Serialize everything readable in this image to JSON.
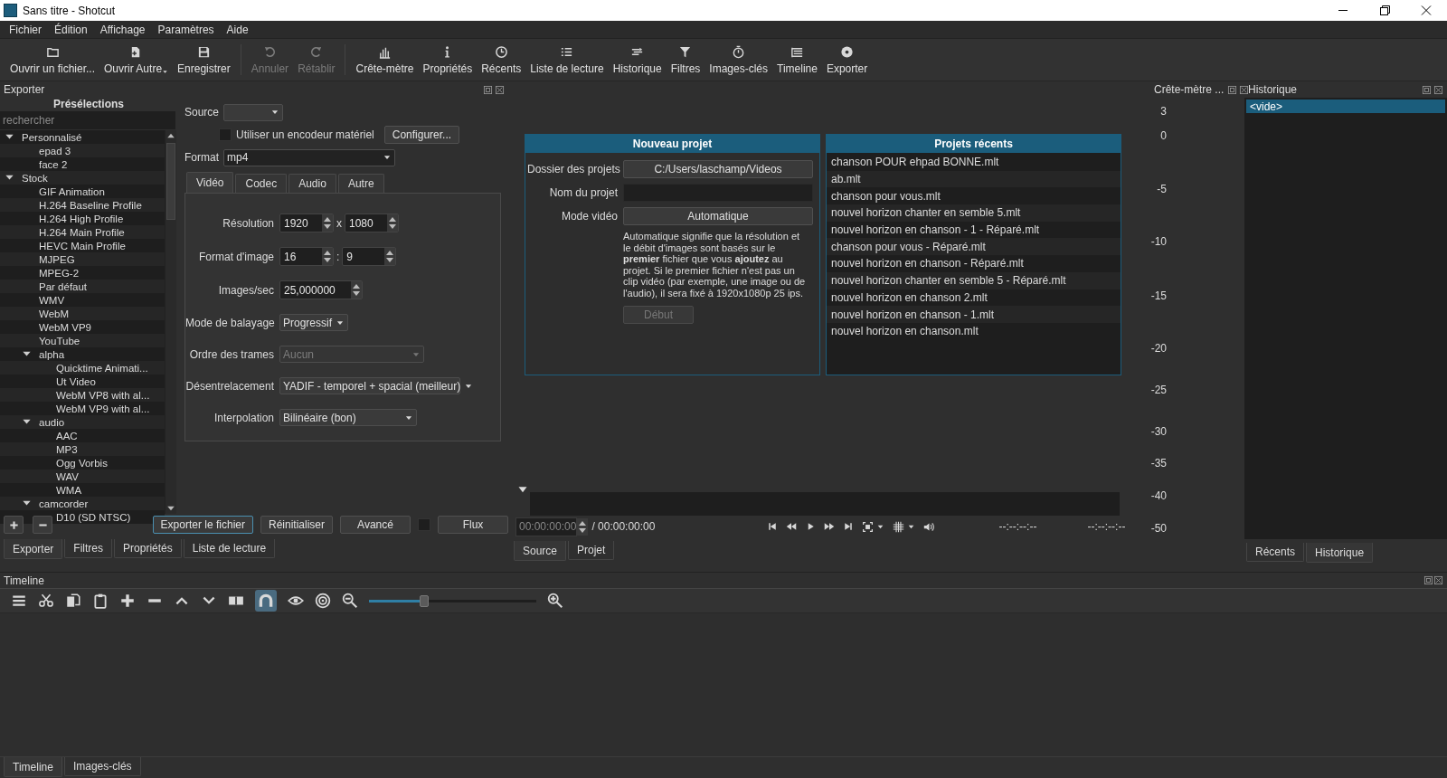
{
  "window": {
    "title": "Sans titre - Shotcut"
  },
  "menu": [
    "Fichier",
    "Édition",
    "Affichage",
    "Paramètres",
    "Aide"
  ],
  "toolbar": [
    {
      "label": "Ouvrir un fichier...",
      "disabled": false
    },
    {
      "label": "Ouvrir Autre",
      "disabled": false
    },
    {
      "label": "Enregistrer",
      "disabled": false
    },
    {
      "label": "Annuler",
      "disabled": true
    },
    {
      "label": "Rétablir",
      "disabled": true
    },
    {
      "label": "Crête-mètre",
      "disabled": false
    },
    {
      "label": "Propriétés",
      "disabled": false
    },
    {
      "label": "Récents",
      "disabled": false
    },
    {
      "label": "Liste de lecture",
      "disabled": false
    },
    {
      "label": "Historique",
      "disabled": false
    },
    {
      "label": "Filtres",
      "disabled": false
    },
    {
      "label": "Images-clés",
      "disabled": false
    },
    {
      "label": "Timeline",
      "disabled": false
    },
    {
      "label": "Exporter",
      "disabled": false
    }
  ],
  "export": {
    "title": "Exporter",
    "presets": {
      "title": "Présélections",
      "search": {
        "placeholder": "rechercher"
      },
      "tree": [
        {
          "label": "Personnalisé",
          "expanded": true,
          "children": [
            {
              "label": "epad 3"
            },
            {
              "label": "face 2"
            }
          ]
        },
        {
          "label": "Stock",
          "expanded": true,
          "children": [
            {
              "label": "GIF Animation"
            },
            {
              "label": "H.264 Baseline Profile"
            },
            {
              "label": "H.264 High Profile"
            },
            {
              "label": "H.264 Main Profile"
            },
            {
              "label": "HEVC Main Profile"
            },
            {
              "label": "MJPEG"
            },
            {
              "label": "MPEG-2"
            },
            {
              "label": "Par défaut"
            },
            {
              "label": "WMV"
            },
            {
              "label": "WebM"
            },
            {
              "label": "WebM VP9"
            },
            {
              "label": "YouTube"
            },
            {
              "label": "alpha",
              "expanded": true,
              "children": [
                {
                  "label": "Quicktime Animati..."
                },
                {
                  "label": "Ut Video"
                },
                {
                  "label": "WebM VP8 with al..."
                },
                {
                  "label": "WebM VP9 with al..."
                }
              ]
            },
            {
              "label": "audio",
              "expanded": true,
              "children": [
                {
                  "label": "AAC"
                },
                {
                  "label": "MP3"
                },
                {
                  "label": "Ogg Vorbis"
                },
                {
                  "label": "WAV"
                },
                {
                  "label": "WMA"
                }
              ]
            },
            {
              "label": "camcorder",
              "expanded": true,
              "children": [
                {
                  "label": "D10 (SD NTSC)"
                }
              ]
            }
          ]
        }
      ]
    },
    "source": {
      "label": "Source"
    },
    "hardware_encoder": {
      "label": "Utiliser un encodeur matériel",
      "checked": false
    },
    "configure_button": "Configurer...",
    "format": {
      "label": "Format",
      "value": "mp4"
    },
    "tabs": [
      {
        "label": "Vidéo",
        "selected": true
      },
      {
        "label": "Codec",
        "selected": false
      },
      {
        "label": "Audio",
        "selected": false
      },
      {
        "label": "Autre",
        "selected": false
      }
    ],
    "fields": [
      {
        "kind": "spin_pair",
        "label": "Résolution",
        "values": [
          "1920",
          "1080"
        ],
        "separator": "x"
      },
      {
        "kind": "spin_pair",
        "label": "Format d'image",
        "values": [
          "16",
          "9"
        ],
        "separator": ":"
      },
      {
        "kind": "spin",
        "label": "Images/sec",
        "value": "25,000000"
      },
      {
        "kind": "select",
        "label": "Mode de balayage",
        "value": "Progressif",
        "disabled": false
      },
      {
        "kind": "select",
        "label": "Ordre des trames",
        "value": "Aucun",
        "disabled": true
      },
      {
        "kind": "select",
        "label": "Désentrelacement",
        "value": "YADIF - temporel + spacial (meilleur)",
        "disabled": false
      },
      {
        "kind": "select",
        "label": "Interpolation",
        "value": "Bilinéaire (bon)",
        "disabled": false
      }
    ],
    "buttons": [
      {
        "kind": "button",
        "label": "Exporter le fichier",
        "focused": true
      },
      {
        "kind": "button",
        "label": "Réinitialiser",
        "focused": false
      },
      {
        "kind": "button",
        "label": "Avancé",
        "focused": false
      },
      {
        "kind": "checkbox",
        "checked": false
      },
      {
        "kind": "button",
        "label": "Flux",
        "focused": false
      }
    ],
    "dock_tabs": [
      {
        "label": "Exporter",
        "selected": true
      },
      {
        "label": "Filtres",
        "selected": false
      },
      {
        "label": "Propriétés",
        "selected": false
      },
      {
        "label": "Liste de lecture",
        "selected": false
      }
    ]
  },
  "start": {
    "new_project": {
      "title": "Nouveau projet",
      "folder": {
        "label": "Dossier des projets",
        "value": "C:/Users/laschamp/Videos"
      },
      "name": {
        "label": "Nom du projet"
      },
      "mode": {
        "label": "Mode vidéo",
        "value": "Automatique"
      },
      "description": "Automatique signifie que la résolution et le débit d'images sont basés sur le **premier** fichier que vous **ajoutez** au projet. Si le premier fichier n'est pas un clip vidéo (par exemple, une image ou de l'audio), il sera fixé à 1920x1080p 25 ips.",
      "start_button": {
        "label": "Début",
        "disabled": true
      }
    },
    "recent": {
      "title": "Projets récents",
      "items": [
        "chanson POUR ehpad BONNE.mlt",
        "ab.mlt",
        "chanson pour vous.mlt",
        "nouvel horizon chanter en semble 5.mlt",
        "nouvel horizon en chanson - 1 - Réparé.mlt",
        "chanson pour vous - Réparé.mlt",
        "nouvel horizon en chanson - Réparé.mlt",
        "nouvel horizon chanter en semble 5 - Réparé.mlt",
        "nouvel horizon en chanson 2.mlt",
        "nouvel horizon en chanson - 1.mlt",
        "nouvel horizon en chanson.mlt"
      ]
    }
  },
  "player": {
    "position": {
      "value": "00:00:00:00",
      "disabled": true
    },
    "duration": "/ 00:00:00:00",
    "in_point": "--:--:--:--",
    "out_point": "--:--:--:--",
    "tabs": [
      {
        "label": "Source",
        "selected": true
      },
      {
        "label": "Projet",
        "selected": false
      }
    ]
  },
  "peak_meter": {
    "title": "Crête-mètre ...",
    "scale": [
      "3",
      "0",
      "-5",
      "-10",
      "-15",
      "-20",
      "-25",
      "-30",
      "-35",
      "-40",
      "-50"
    ]
  },
  "history": {
    "title": "Historique",
    "items": [
      {
        "label": "<vide>",
        "selected": true
      }
    ],
    "tabs": [
      {
        "label": "Récents",
        "selected": false
      },
      {
        "label": "Historique",
        "selected": true
      }
    ]
  },
  "timeline": {
    "title": "Timeline",
    "snap": {
      "on": true
    },
    "zoom": {
      "level": 0.33
    },
    "tabs": [
      {
        "label": "Timeline",
        "selected": true
      },
      {
        "label": "Images-clés",
        "selected": false
      }
    ]
  }
}
